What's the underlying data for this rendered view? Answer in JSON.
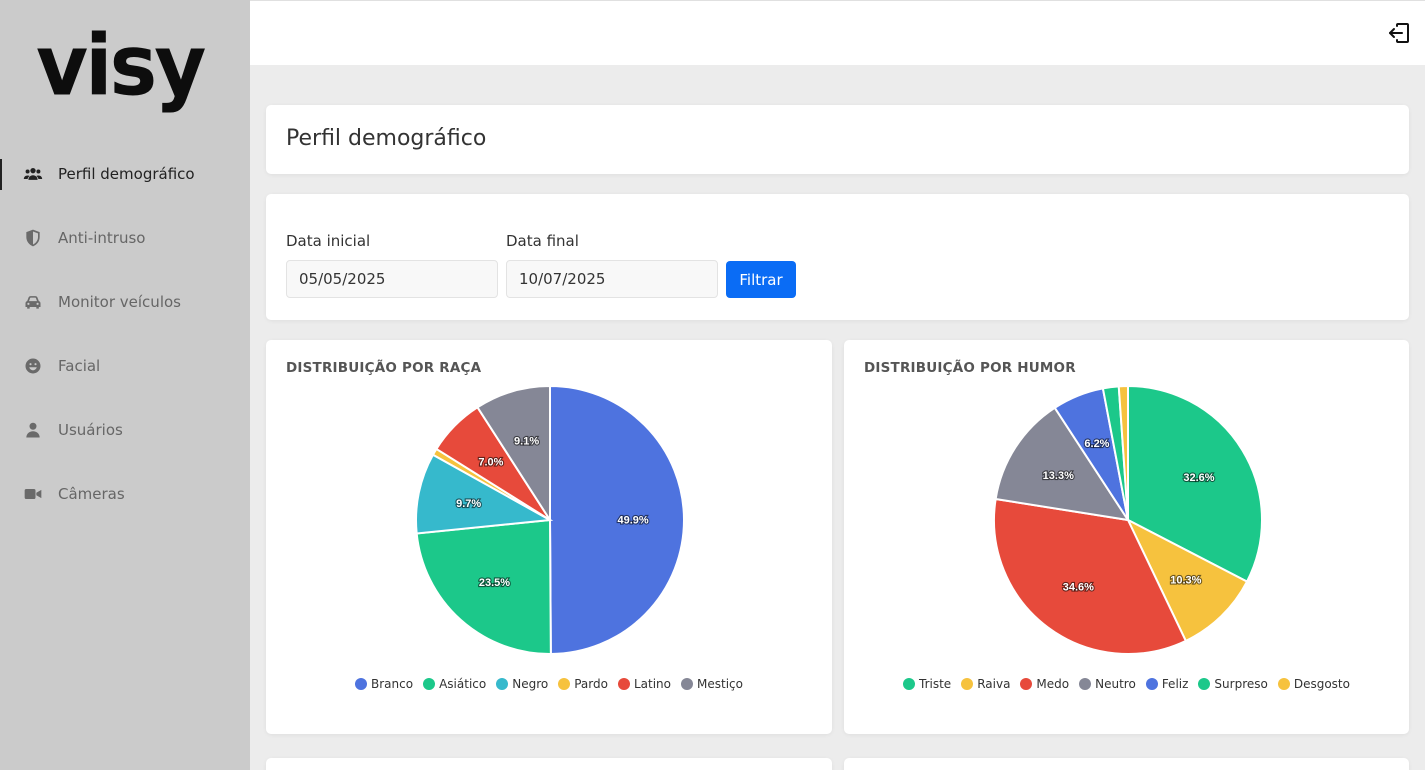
{
  "brand": {
    "logo_text": "visy"
  },
  "sidebar": {
    "items": [
      {
        "label": "Perfil demográfico",
        "icon": "users-icon",
        "active": true
      },
      {
        "label": "Anti-intruso",
        "icon": "shield-icon",
        "active": false
      },
      {
        "label": "Monitor veículos",
        "icon": "car-icon",
        "active": false
      },
      {
        "label": "Facial",
        "icon": "smile-icon",
        "active": false
      },
      {
        "label": "Usuários",
        "icon": "user-icon",
        "active": false
      },
      {
        "label": "Câmeras",
        "icon": "video-camera-icon",
        "active": false
      }
    ]
  },
  "topbar": {
    "logout_icon": "logout-icon"
  },
  "page": {
    "title": "Perfil demográfico"
  },
  "filter": {
    "start_label": "Data inicial",
    "start_value": "05/05/2025",
    "end_label": "Data final",
    "end_value": "10/07/2025",
    "button_label": "Filtrar",
    "button_color": "#0a6cf5"
  },
  "chart_data": [
    {
      "type": "pie",
      "title": "DISTRIBUIÇÃO POR RAÇA",
      "categories": [
        "Branco",
        "Asiático",
        "Negro",
        "Pardo",
        "Latino",
        "Mestiço"
      ],
      "values": [
        49.9,
        23.5,
        9.7,
        0.8,
        7.0,
        9.1
      ],
      "labels": [
        "49.9%",
        "23.5%",
        "9.7%",
        "",
        "7.0%",
        "9.1%"
      ],
      "colors": [
        "#4e73df",
        "#1cc88a",
        "#36b9cc",
        "#f6c23e",
        "#e74a3b",
        "#858796"
      ],
      "legend": "bottom"
    },
    {
      "type": "pie",
      "title": "DISTRIBUIÇÃO POR HUMOR",
      "categories": [
        "Triste",
        "Raiva",
        "Medo",
        "Neutro",
        "Feliz",
        "Surpreso",
        "Desgosto"
      ],
      "values": [
        32.6,
        10.3,
        34.6,
        13.3,
        6.2,
        1.9,
        1.1
      ],
      "labels": [
        "32.6%",
        "10.3%",
        "34.6%",
        "13.3%",
        "6.2%",
        "",
        ""
      ],
      "colors": [
        "#1cc88a",
        "#f6c23e",
        "#e74a3b",
        "#858796",
        "#4e73df",
        "#1cc88a",
        "#f6c23e"
      ],
      "legend": "bottom"
    }
  ]
}
